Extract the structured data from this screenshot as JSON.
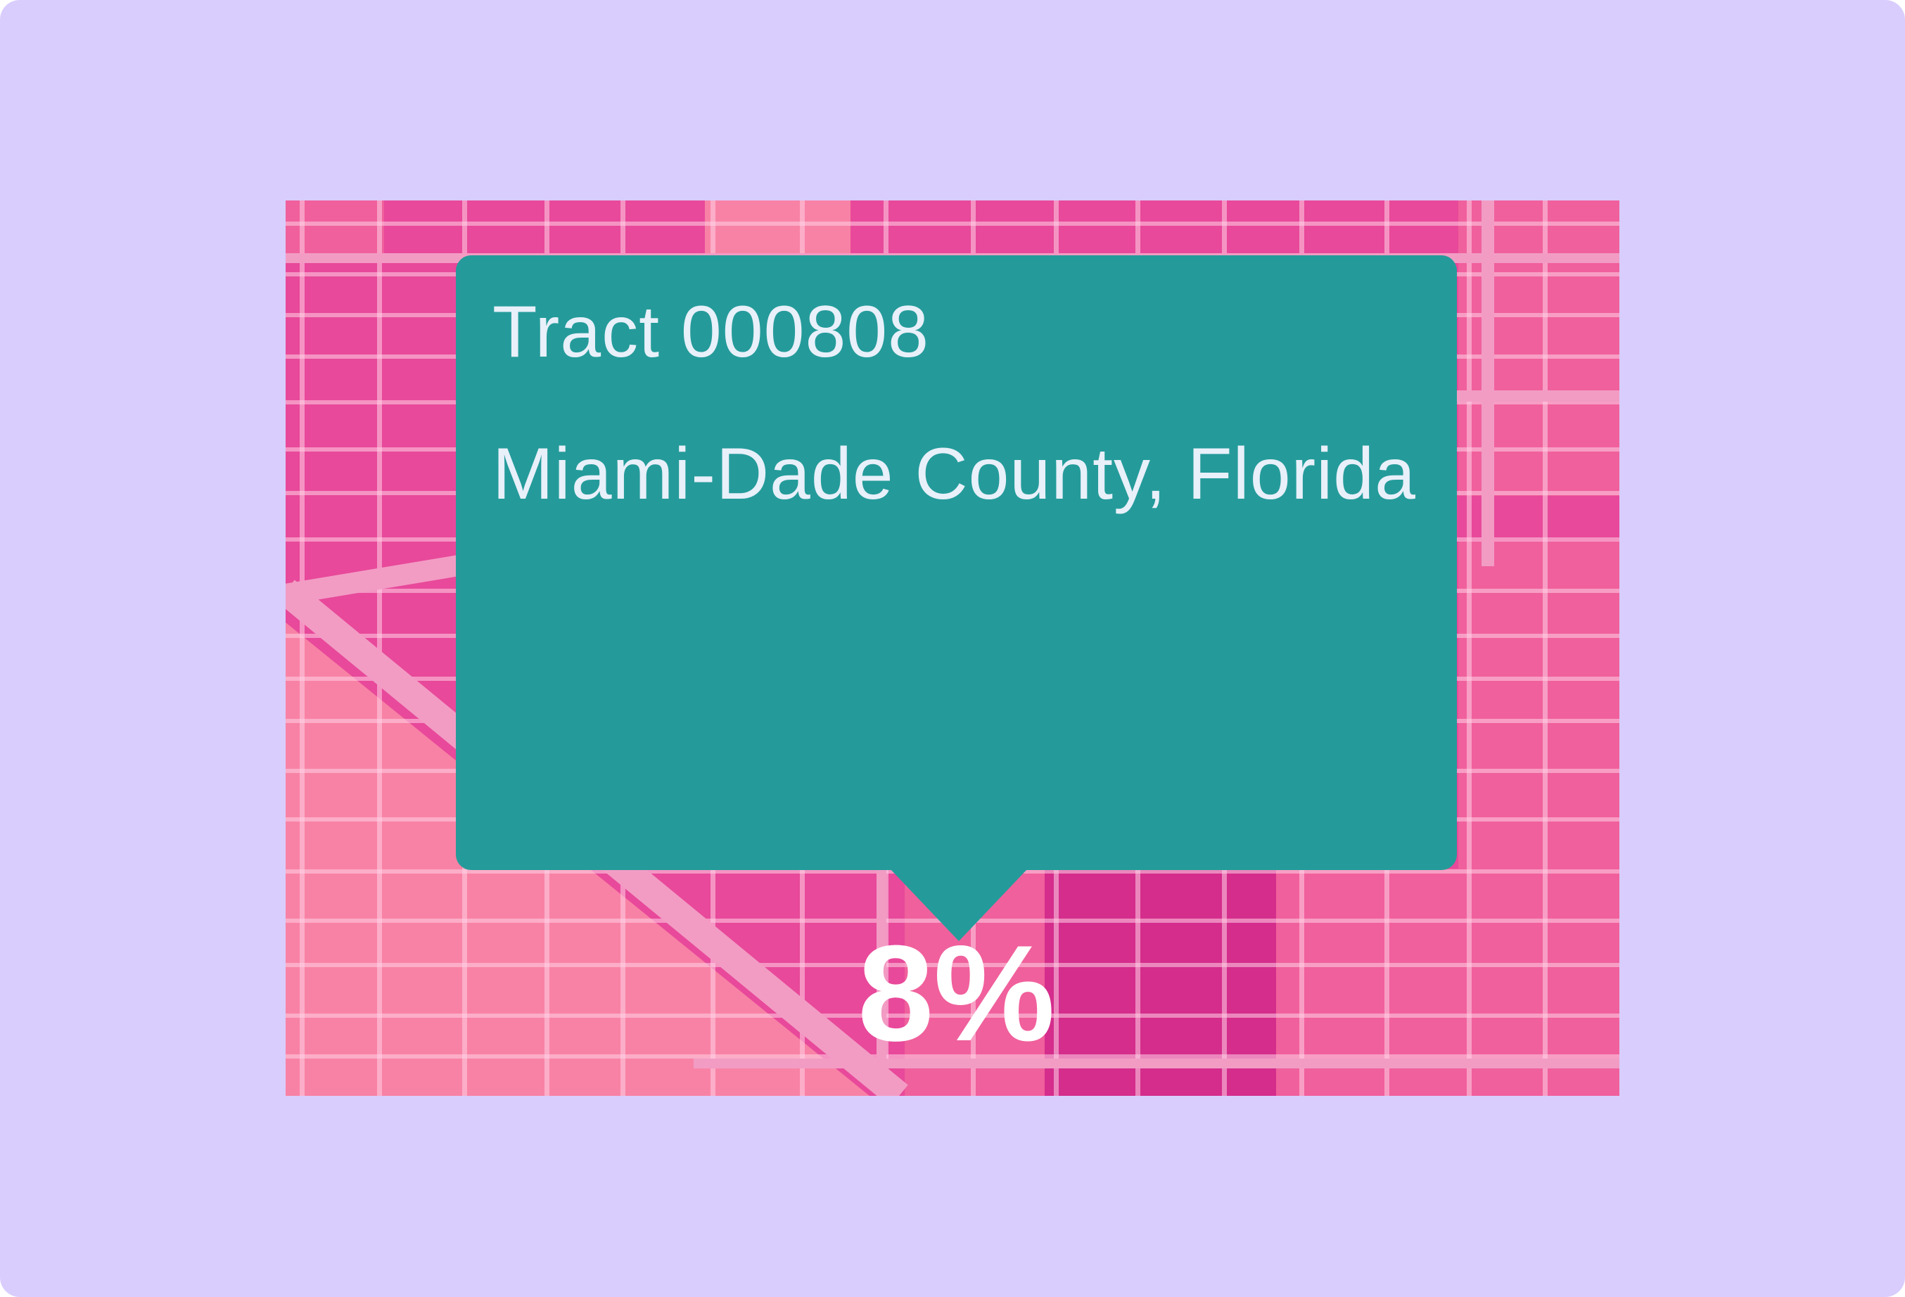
{
  "tooltip": {
    "tract": "Tract 000808",
    "location": "Miami-Dade County, Florida",
    "value": "8%"
  },
  "colors": {
    "frame": "#d9cdfd",
    "tooltip": "#249b9a",
    "map_medium": "#e8499a",
    "map_light": "#f882a5",
    "map_mid_light": "#f0609c",
    "map_dark": "#d42d8c",
    "road": "#f29cc4"
  }
}
